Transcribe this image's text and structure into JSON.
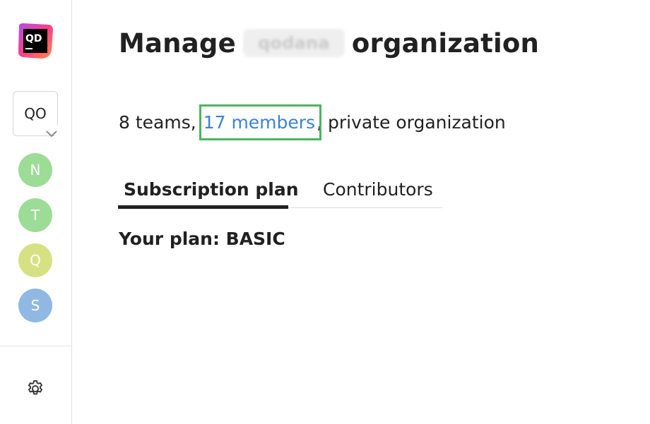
{
  "sidebar": {
    "logo_text": "QD",
    "org_switcher_label": "QO",
    "avatars": [
      {
        "letter": "N",
        "color": "#9cdc96"
      },
      {
        "letter": "T",
        "color": "#9cdc96"
      },
      {
        "letter": "Q",
        "color": "#d6e184"
      },
      {
        "letter": "S",
        "color": "#8fb9e3"
      }
    ]
  },
  "header": {
    "title_prefix": "Manage",
    "org_name_redacted": "qodana",
    "title_suffix": "organization"
  },
  "summary": {
    "teams": "8 teams,",
    "members": "17 members",
    "visibility": ", private organization"
  },
  "tabs": [
    {
      "label": "Subscription plan",
      "active": true
    },
    {
      "label": "Contributors",
      "active": false
    }
  ],
  "plan": {
    "text": "Your plan: BASIC"
  },
  "colors": {
    "link": "#3b82d6",
    "highlight": "#4bb562"
  }
}
